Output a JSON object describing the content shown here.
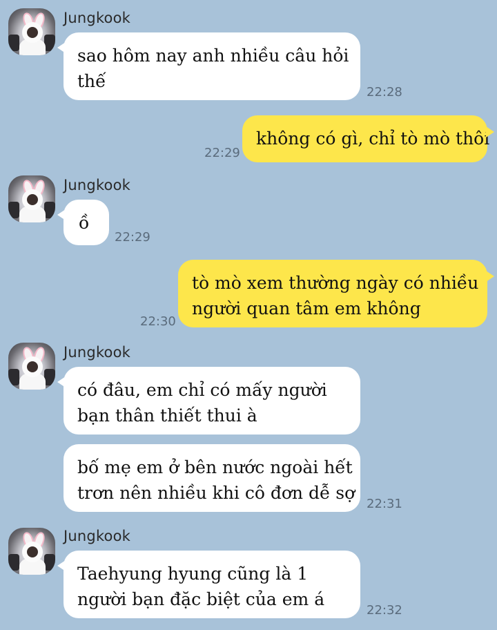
{
  "messages": [
    {
      "sender": "Jungkook",
      "direction": "incoming",
      "bubbles": [
        {
          "lines": [
            "sao hôm nay anh nhiều câu hỏi",
            "thế"
          ],
          "time": "22:28"
        }
      ]
    },
    {
      "direction": "outgoing",
      "bubbles": [
        {
          "lines": [
            "không có gì, chỉ tò mò thôi"
          ],
          "time": "22:29"
        }
      ]
    },
    {
      "sender": "Jungkook",
      "direction": "incoming",
      "bubbles": [
        {
          "lines": [
            "ồ"
          ],
          "time": "22:29"
        }
      ]
    },
    {
      "direction": "outgoing",
      "bubbles": [
        {
          "lines": [
            "tò mò xem thường ngày có nhiều",
            "người quan tâm em không"
          ],
          "time": "22:30"
        }
      ]
    },
    {
      "sender": "Jungkook",
      "direction": "incoming",
      "bubbles": [
        {
          "lines": [
            "có đâu, em chỉ có mấy người",
            "bạn thân thiết thui à"
          ]
        },
        {
          "lines": [
            "bố mẹ em ở bên nước ngoài hết",
            "trơn nên nhiều khi cô đơn dễ sợ"
          ],
          "time": "22:31"
        }
      ]
    },
    {
      "sender": "Jungkook",
      "direction": "incoming",
      "bubbles": [
        {
          "lines": [
            "Taehyung hyung cũng là 1",
            "người bạn đặc biệt của em á"
          ],
          "time": "22:32"
        }
      ]
    }
  ],
  "colors": {
    "background": "#a8c2d9",
    "incoming_bubble": "#ffffff",
    "outgoing_bubble": "#fde64b",
    "timestamp": "#5a6b7c"
  },
  "icons": {
    "avatar": "profile-avatar-bunny-hood"
  }
}
